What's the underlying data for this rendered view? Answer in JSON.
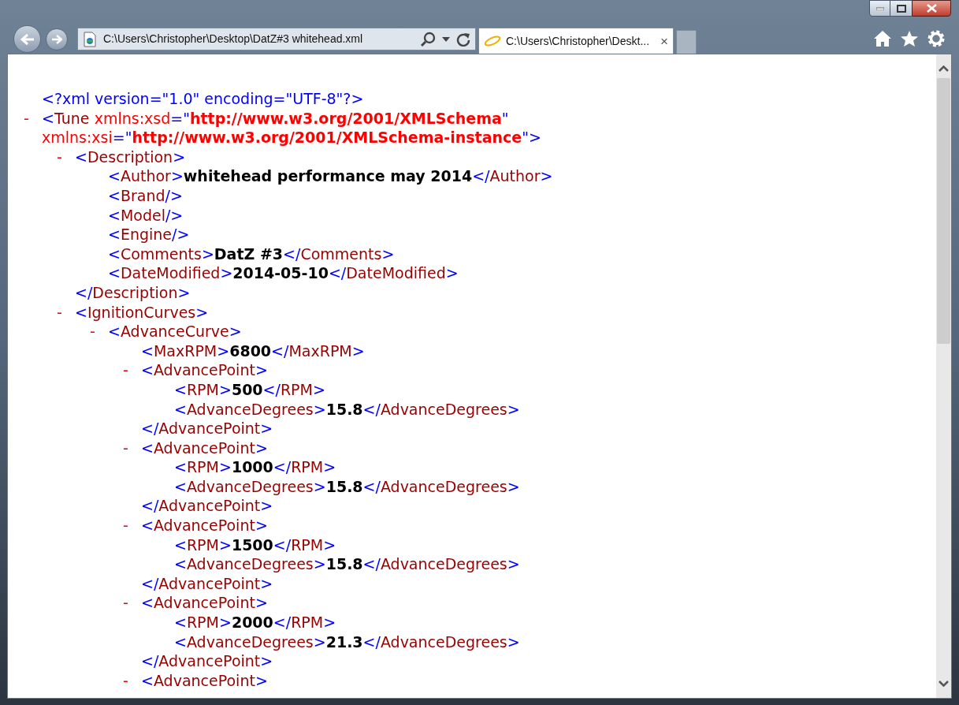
{
  "browser": {
    "address": "C:\\Users\\Christopher\\Desktop\\DatZ#3 whitehead.xml",
    "tabs": [
      {
        "title": "C:\\Users\\Christopher\\Deskt...",
        "close": "×",
        "selected": true
      }
    ]
  },
  "syntax": {
    "open": "<",
    "close": ">",
    "end_open": "</",
    "self_close": "/>",
    "eq": "=\"",
    "quote": "\""
  },
  "document": [
    {
      "kind": "declaration",
      "text": "<?xml version=\"1.0\" encoding=\"UTF-8\"?>"
    },
    {
      "kind": "parent",
      "mark": "-",
      "tag": "Tune",
      "attributes": [
        {
          "name": "xmlns:xsd",
          "value": "http://www.w3.org/2001/XMLSchema"
        },
        {
          "name": "xmlns:xsi",
          "value": "http://www.w3.org/2001/XMLSchema-instance"
        }
      ],
      "children": [
        {
          "kind": "parent",
          "mark": "-",
          "tag": "Description",
          "end_tag": "Description",
          "children": [
            {
              "kind": "leaf",
              "tag": "Author",
              "value": "whitehead performance may 2014",
              "end_tag": "Author"
            },
            {
              "kind": "empty",
              "tag": "Brand"
            },
            {
              "kind": "empty",
              "tag": "Model"
            },
            {
              "kind": "empty",
              "tag": "Engine"
            },
            {
              "kind": "leaf",
              "tag": "Comments",
              "value": "DatZ #3",
              "end_tag": "Comments"
            },
            {
              "kind": "leaf",
              "tag": "DateModified",
              "value": "2014-05-10",
              "end_tag": "DateModified"
            }
          ]
        },
        {
          "kind": "parent",
          "mark": "-",
          "tag": "IgnitionCurves",
          "children": [
            {
              "kind": "parent",
              "mark": "-",
              "tag": "AdvanceCurve",
              "children": [
                {
                  "kind": "leaf",
                  "tag": "MaxRPM",
                  "value": "6800",
                  "end_tag": "MaxRPM"
                },
                {
                  "kind": "parent",
                  "mark": "-",
                  "tag": "AdvancePoint",
                  "end_tag": "AdvancePoint",
                  "children": [
                    {
                      "kind": "leaf",
                      "tag": "RPM",
                      "value": "500",
                      "end_tag": "RPM"
                    },
                    {
                      "kind": "leaf",
                      "tag": "AdvanceDegrees",
                      "value": "15.8",
                      "end_tag": "AdvanceDegrees"
                    }
                  ]
                },
                {
                  "kind": "parent",
                  "mark": "-",
                  "tag": "AdvancePoint",
                  "end_tag": "AdvancePoint",
                  "children": [
                    {
                      "kind": "leaf",
                      "tag": "RPM",
                      "value": "1000",
                      "end_tag": "RPM"
                    },
                    {
                      "kind": "leaf",
                      "tag": "AdvanceDegrees",
                      "value": "15.8",
                      "end_tag": "AdvanceDegrees"
                    }
                  ]
                },
                {
                  "kind": "parent",
                  "mark": "-",
                  "tag": "AdvancePoint",
                  "end_tag": "AdvancePoint",
                  "children": [
                    {
                      "kind": "leaf",
                      "tag": "RPM",
                      "value": "1500",
                      "end_tag": "RPM"
                    },
                    {
                      "kind": "leaf",
                      "tag": "AdvanceDegrees",
                      "value": "15.8",
                      "end_tag": "AdvanceDegrees"
                    }
                  ]
                },
                {
                  "kind": "parent",
                  "mark": "-",
                  "tag": "AdvancePoint",
                  "end_tag": "AdvancePoint",
                  "children": [
                    {
                      "kind": "leaf",
                      "tag": "RPM",
                      "value": "2000",
                      "end_tag": "RPM"
                    },
                    {
                      "kind": "leaf",
                      "tag": "AdvanceDegrees",
                      "value": "21.3",
                      "end_tag": "AdvanceDegrees"
                    }
                  ]
                },
                {
                  "kind": "parent",
                  "mark": "-",
                  "tag": "AdvancePoint"
                }
              ]
            }
          ]
        }
      ]
    }
  ]
}
